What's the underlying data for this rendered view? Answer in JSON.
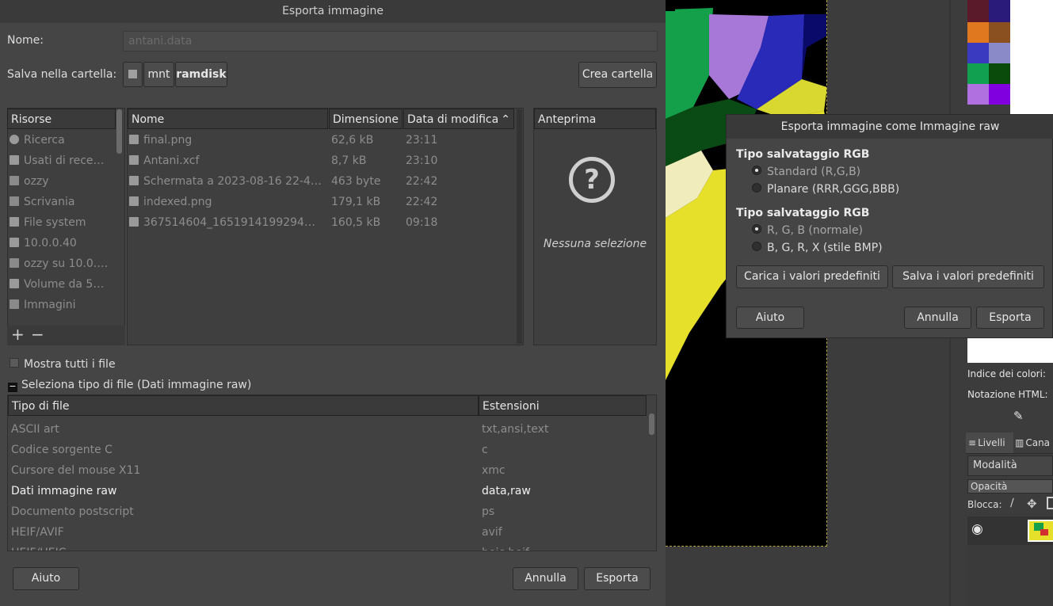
{
  "export_dialog": {
    "title": "Esporta immagine",
    "name_label": "Nome:",
    "name_value": "antani.data",
    "folder_label": "Salva nella cartella:",
    "path": [
      "mnt",
      "ramdisk"
    ],
    "create_folder": "Crea cartella",
    "places_header": "Risorse",
    "places": [
      {
        "label": "Ricerca",
        "icon": "search-icon"
      },
      {
        "label": "Usati di rece…",
        "icon": "recent-icon"
      },
      {
        "label": "ozzy",
        "icon": "folder-icon"
      },
      {
        "label": "Scrivania",
        "icon": "folder-icon"
      },
      {
        "label": "File system",
        "icon": "drive-icon"
      },
      {
        "label": "10.0.0.40",
        "icon": "network-icon"
      },
      {
        "label": "ozzy su 10.0.…",
        "icon": "folder-icon"
      },
      {
        "label": "Volume da 5…",
        "icon": "drive-icon"
      },
      {
        "label": "Immagini",
        "icon": "folder-icon"
      }
    ],
    "files_headers": {
      "name": "Nome",
      "size": "Dimensione",
      "modified": "Data di modifica"
    },
    "files": [
      {
        "name": "final.png",
        "size": "62,6 kB",
        "modified": "23:11"
      },
      {
        "name": "Antani.xcf",
        "size": "8,7 kB",
        "modified": "23:10"
      },
      {
        "name": "Schermata a 2023-08-16 22-4…",
        "size": "463 byte",
        "modified": "22:42"
      },
      {
        "name": "indexed.png",
        "size": "179,1 kB",
        "modified": "22:42"
      },
      {
        "name": "367514604_1651914199294…",
        "size": "160,5 kB",
        "modified": "09:18"
      }
    ],
    "preview_header": "Anteprima",
    "preview_text": "Nessuna selezione",
    "show_all": "Mostra tutti i file",
    "select_type": "Seleziona tipo di file (Dati immagine raw)",
    "types_headers": {
      "type": "Tipo di file",
      "ext": "Estensioni"
    },
    "types": [
      {
        "type": "ASCII art",
        "ext": "txt,ansi,text"
      },
      {
        "type": "Codice sorgente C",
        "ext": "c"
      },
      {
        "type": "Cursore del mouse X11",
        "ext": "xmc"
      },
      {
        "type": "Dati immagine raw",
        "ext": "data,raw"
      },
      {
        "type": "Documento postscript",
        "ext": "ps"
      },
      {
        "type": "HEIF/AVIF",
        "ext": "avif"
      },
      {
        "type": "HEIF/HEIC",
        "ext": "heic,heif"
      }
    ],
    "help": "Aiuto",
    "cancel": "Annulla",
    "export": "Esporta"
  },
  "raw_dialog": {
    "title": "Esporta immagine come Immagine raw",
    "group1_title": "Tipo salvataggio RGB",
    "group1_options": [
      "Standard (R,G,B)",
      "Planare (RRR,GGG,BBB)"
    ],
    "group2_title": "Tipo salvataggio RGB",
    "group2_options": [
      "R, G, B (normale)",
      "B, G, R, X (stile BMP)"
    ],
    "load_defaults": "Carica i valori predefiniti",
    "save_defaults": "Salva i valori predefiniti",
    "help": "Aiuto",
    "cancel": "Annulla",
    "export": "Esporta"
  },
  "dock": {
    "color_index": "Indice dei colori:",
    "html_notation": "Notazione HTML:",
    "tab_layers": "Livelli",
    "tab_channels": "Cana",
    "mode": "Modalità",
    "opacity": "Opacità",
    "lock": "Blocca:",
    "palette": [
      "#5a1a2a",
      "#2a1a7a",
      "#e07820",
      "#8a5020",
      "#3a3ac0",
      "#8a8ac8",
      "#10a050",
      "#0a4a0a",
      "#b070e0",
      "#8000e0"
    ]
  }
}
